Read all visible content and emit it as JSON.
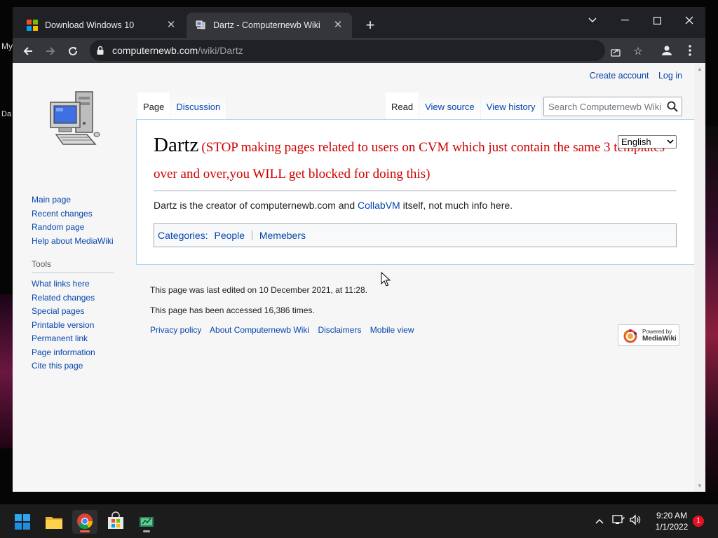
{
  "desktop": {
    "label_top": "My",
    "label_mid": "Da"
  },
  "browser": {
    "tabs": [
      {
        "title": "Download Windows 10",
        "active": false
      },
      {
        "title": "Dartz - Computernewb Wiki",
        "active": true
      }
    ],
    "new_tab_symbol": "+",
    "url_host": "computernewb.com",
    "url_path": "/wiki/Dartz"
  },
  "wiki": {
    "personal": {
      "create_account": "Create account",
      "login": "Log in"
    },
    "sidebar": {
      "nav": [
        "Main page",
        "Recent changes",
        "Random page",
        "Help about MediaWiki"
      ],
      "tools_heading": "Tools",
      "tools": [
        "What links here",
        "Related changes",
        "Special pages",
        "Printable version",
        "Permanent link",
        "Page information",
        "Cite this page"
      ]
    },
    "tabs_left": [
      {
        "label": "Page",
        "selected": true
      },
      {
        "label": "Discussion",
        "selected": false
      }
    ],
    "tabs_right": [
      {
        "label": "Read",
        "selected": true
      },
      {
        "label": "View source",
        "selected": false
      },
      {
        "label": "View history",
        "selected": false
      }
    ],
    "search_placeholder": "Search Computernewb Wiki",
    "language": "English",
    "title": "Dartz",
    "title_warning": "(STOP making pages related to users on CVM which just contain the same 3 templates over and over,you WILL get blocked for doing this)",
    "body": {
      "before": "Dartz is the creator of computernewb.com and ",
      "link": "CollabVM",
      "after": " itself, not much info here."
    },
    "categories": {
      "label": "Categories:",
      "items": [
        "People",
        "Memebers"
      ]
    },
    "footer": {
      "last_edited": "This page was last edited on 10 December 2021, at 11:28.",
      "accessed": "This page has been accessed 16,386 times.",
      "links": [
        "Privacy policy",
        "About Computernewb Wiki",
        "Disclaimers",
        "Mobile view"
      ],
      "powered_by_top": "Powered by",
      "powered_by_bottom": "MediaWiki"
    }
  },
  "taskbar": {
    "time": "9:20 AM",
    "date": "1/1/2022",
    "notification_count": "1"
  },
  "colors": {
    "link": "#0645ad",
    "warning": "#d00000",
    "chrome_dark": "#202124",
    "chrome_toolbar": "#35363a"
  },
  "icons": [
    "windows-logo-icon",
    "wiki-favicon-icon",
    "close-icon",
    "minimize-icon",
    "maximize-icon",
    "tab-search-icon",
    "back-icon",
    "forward-icon",
    "reload-icon",
    "lock-icon",
    "share-icon",
    "star-icon",
    "profile-icon",
    "menu-icon",
    "search-icon",
    "start-icon",
    "file-explorer-icon",
    "chrome-icon",
    "store-icon",
    "app-icon",
    "chevron-up-icon",
    "network-icon",
    "volume-icon"
  ]
}
